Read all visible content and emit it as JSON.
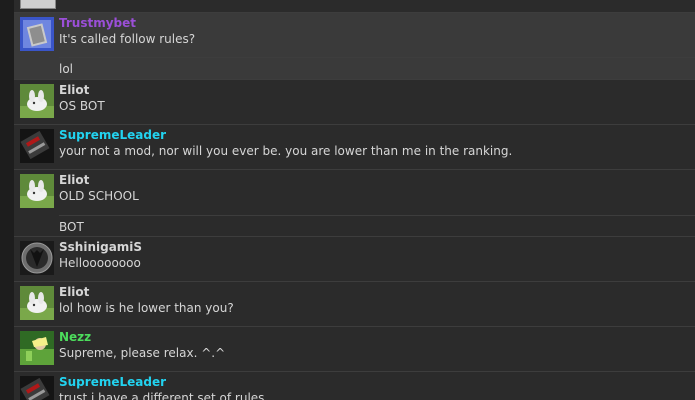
{
  "colors": {
    "purple_name": "#9b4fd8",
    "cyan_name": "#22d3f0",
    "green_name": "#4cdc5c",
    "default_name": "#d6d6d6",
    "text": "#d6d6d6"
  },
  "messages": [
    {
      "username": "Trustmybet",
      "name_color": "purple",
      "avatar": "portrait-avatar-icon",
      "text": "It's called follow rules?",
      "continuation": "lol"
    },
    {
      "username": "Eliot",
      "name_color": "default",
      "avatar": "bunny-avatar-icon",
      "text": "OS BOT"
    },
    {
      "username": "SupremeLeader",
      "name_color": "cyan",
      "avatar": "dark-avatar-icon",
      "text": "your not a mod, nor will you ever be. you are lower than me in the ranking."
    },
    {
      "username": "Eliot",
      "name_color": "default",
      "avatar": "bunny-avatar-icon",
      "text": "OLD SCHOOL",
      "continuation": "BOT"
    },
    {
      "username": "SshinigamiS",
      "name_color": "default",
      "avatar": "shinigami-avatar-icon",
      "text": "Helloooooooo"
    },
    {
      "username": "Eliot",
      "name_color": "default",
      "avatar": "bunny-avatar-icon",
      "text": "lol how is he lower than you?"
    },
    {
      "username": "Nezz",
      "name_color": "green",
      "avatar": "nezz-avatar-icon",
      "text": "Supreme, please relax. ^.^"
    },
    {
      "username": "SupremeLeader",
      "name_color": "cyan",
      "avatar": "dark-avatar-icon",
      "text": "trust i have a different set of rules"
    }
  ]
}
